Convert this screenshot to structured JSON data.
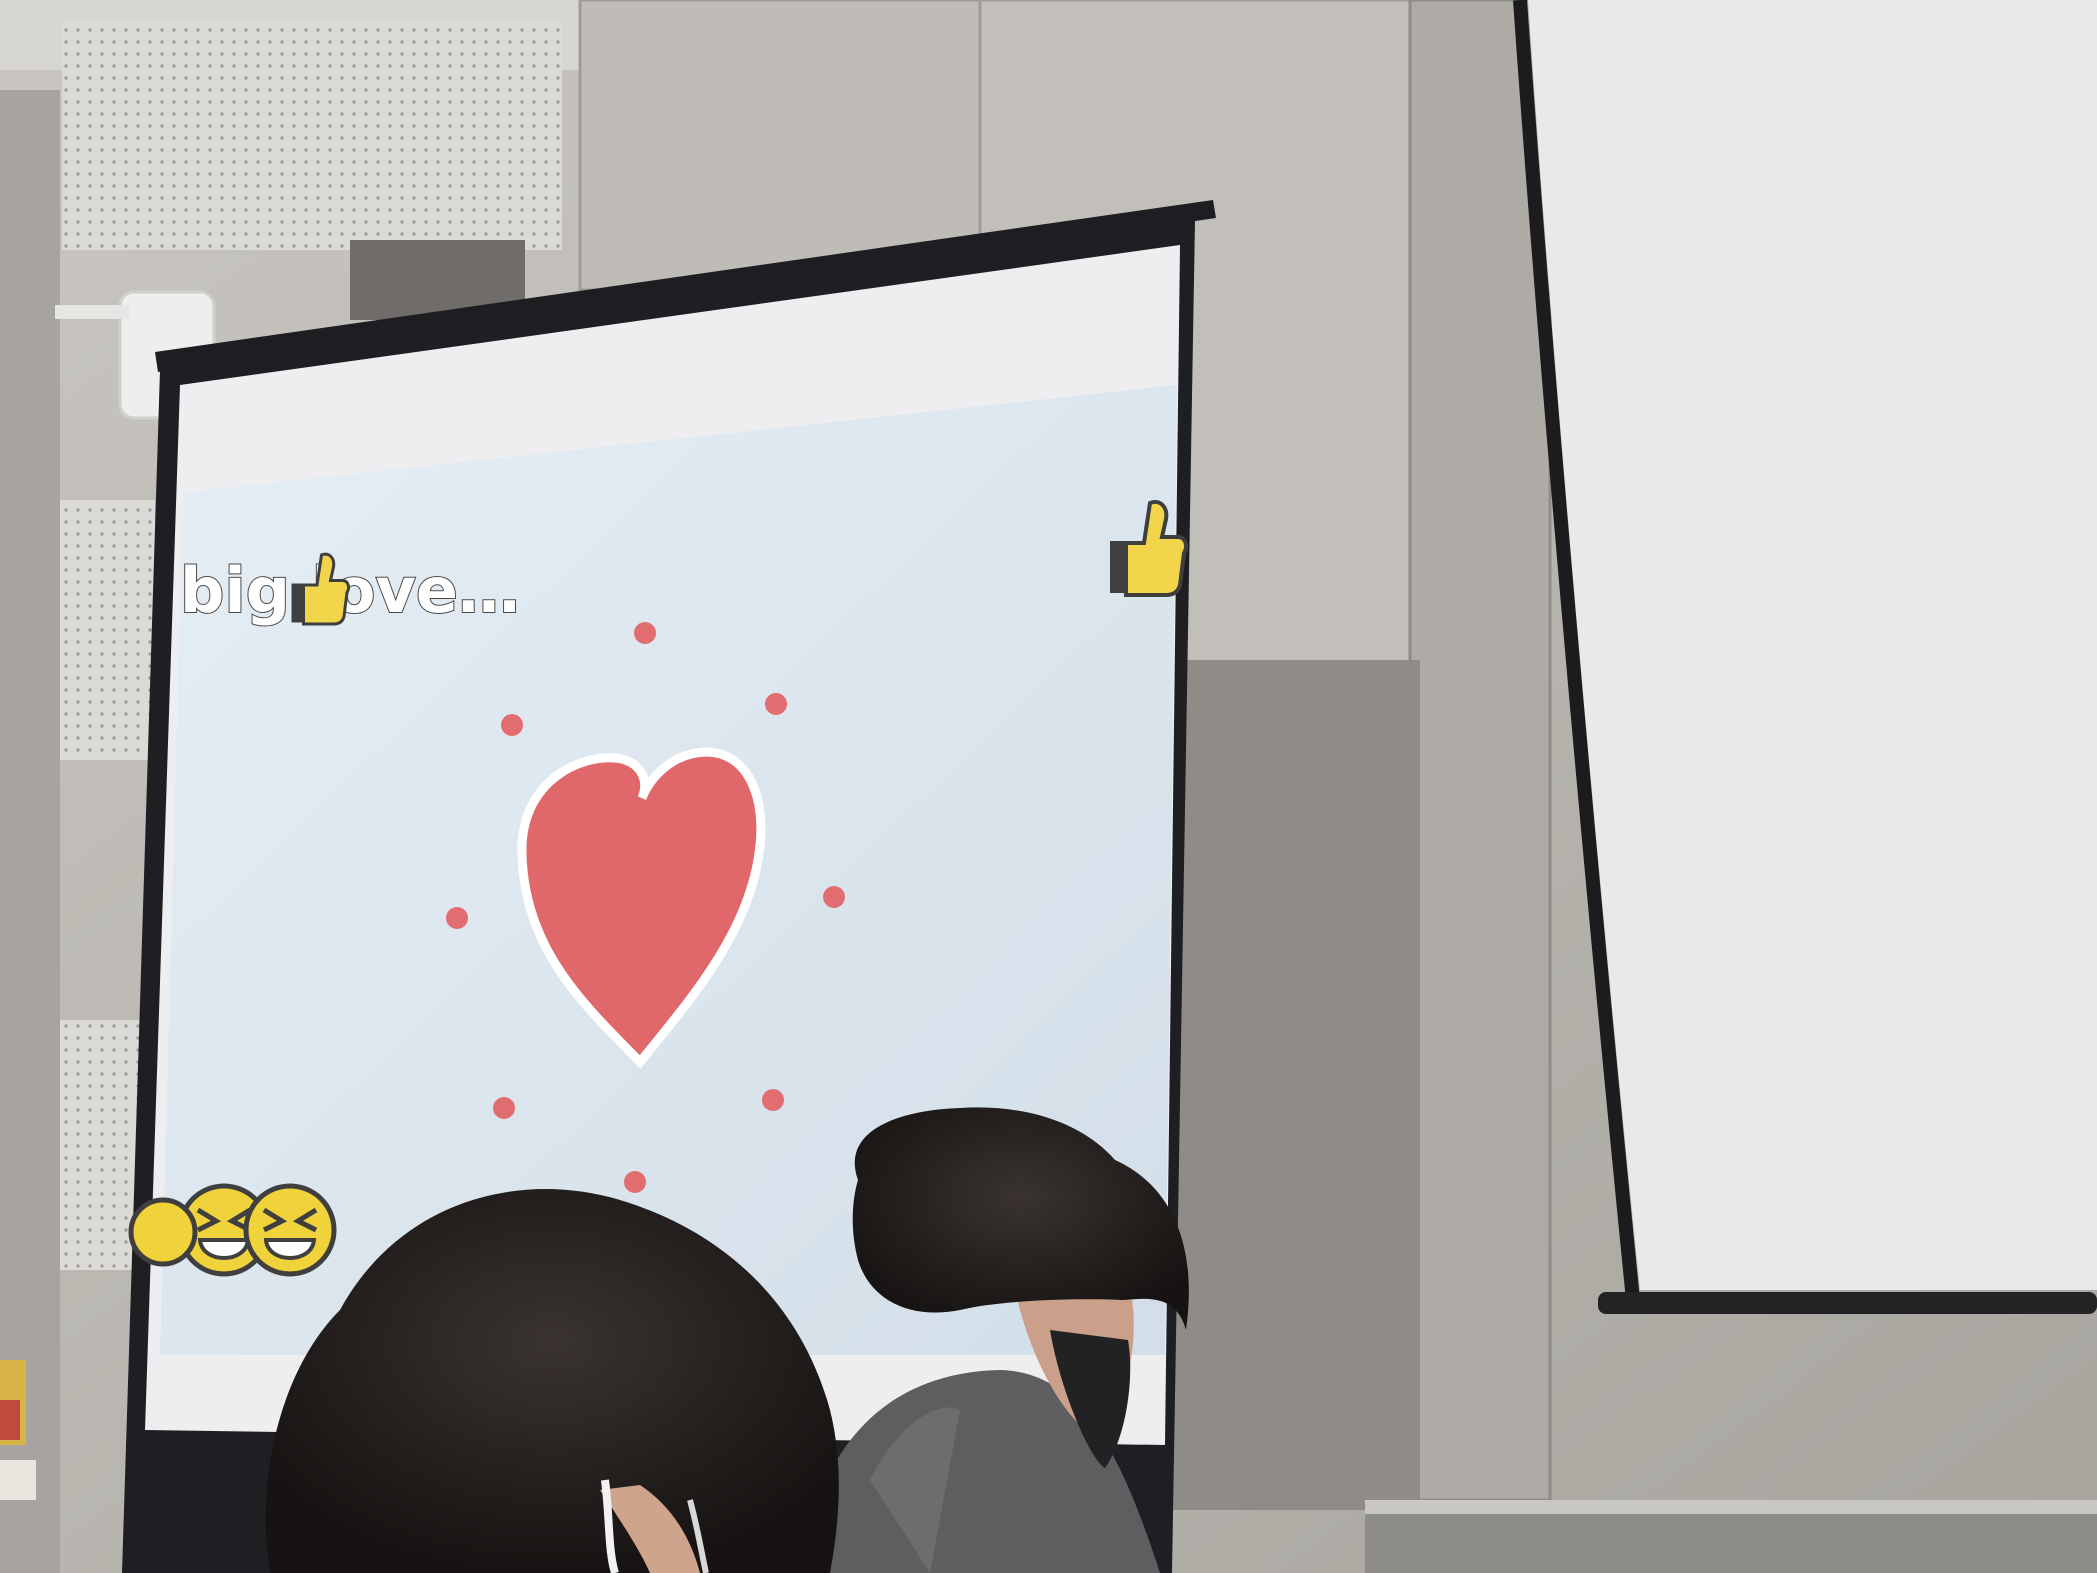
{
  "slide": {
    "caption": "big love…",
    "colors": {
      "background": "#dfe8f0",
      "heart": "#e0686a",
      "sparkle": "#e26d70",
      "emoji": "#f0d23a",
      "thumb": "#f3d54c"
    }
  },
  "scene_colors": {
    "wall": "#b9b6b1",
    "screen_frame": "#1e1f22",
    "right_screen": "#ebe9e7",
    "hair": "#25211f",
    "jacket": "#5e5e60"
  }
}
